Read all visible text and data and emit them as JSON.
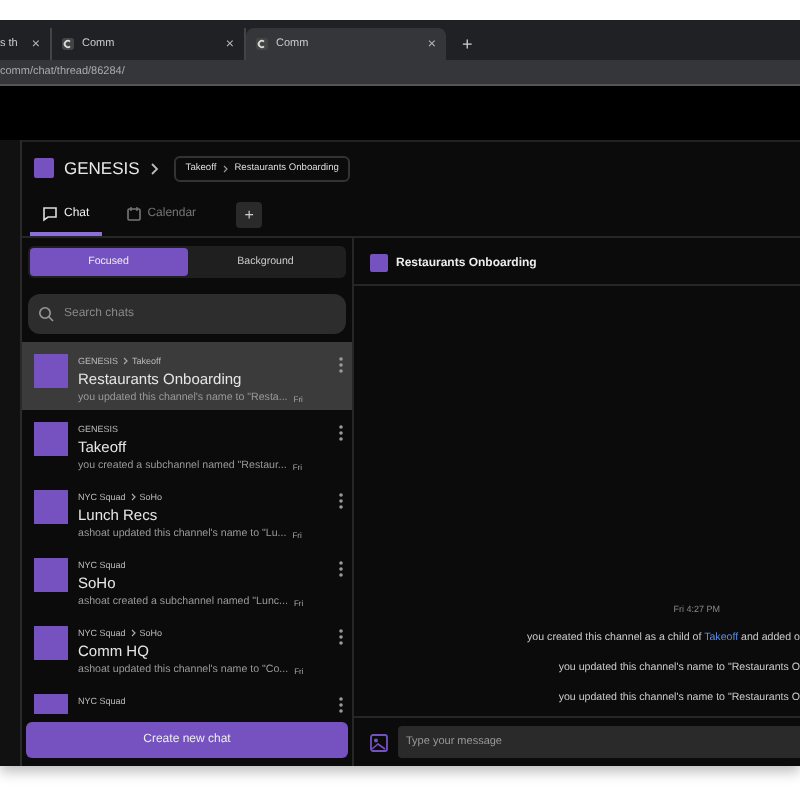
{
  "browser": {
    "tabs": [
      {
        "title": "s th",
        "close": "×",
        "selected": false
      },
      {
        "title": "Comm",
        "close": "×",
        "selected": false
      },
      {
        "title": "Comm",
        "close": "×",
        "selected": true
      }
    ],
    "new_tab": "+",
    "url": "comm/chat/thread/86284/"
  },
  "app": {
    "community": "GENESIS",
    "breadcrumb": [
      "Takeoff",
      "Restaurants Onboarding"
    ],
    "tabs": [
      {
        "label": "Chat",
        "kind": "chat",
        "selected": true
      },
      {
        "label": "Calendar",
        "kind": "calendar",
        "selected": false
      }
    ],
    "add_tab": "+"
  },
  "chat_filter": [
    {
      "label": "Focused",
      "selected": true
    },
    {
      "label": "Background",
      "selected": false
    }
  ],
  "search": {
    "placeholder": "Search chats"
  },
  "chats": [
    {
      "path": [
        "GENESIS",
        "Takeoff"
      ],
      "name": "Restaurants Onboarding",
      "preview": "you updated this channel's name to \"Resta...",
      "time": "Fri",
      "selected": true
    },
    {
      "path": [
        "GENESIS"
      ],
      "name": "Takeoff",
      "preview": "you created a subchannel named \"Restaur...",
      "time": "Fri",
      "selected": false
    },
    {
      "path": [
        "NYC Squad",
        "SoHo"
      ],
      "name": "Lunch Recs",
      "preview": "ashoat updated this channel's name to \"Lu...",
      "time": "Fri",
      "selected": false
    },
    {
      "path": [
        "NYC Squad"
      ],
      "name": "SoHo",
      "preview": "ashoat created a subchannel named \"Lunc...",
      "time": "Fri",
      "selected": false
    },
    {
      "path": [
        "NYC Squad",
        "SoHo"
      ],
      "name": "Comm HQ",
      "preview": "ashoat updated this channel's name to \"Co...",
      "time": "Fri",
      "selected": false
    },
    {
      "path": [
        "NYC Squad"
      ],
      "selected": false
    }
  ],
  "create_button": "Create new chat",
  "thread": {
    "title": "Restaurants Onboarding",
    "timestamp": "Fri 4:27 PM",
    "messages": [
      {
        "text": "you created this channel as a child of ",
        "link": "Takeoff",
        "after": " and added o"
      },
      {
        "text": "you updated this channel's name to \"Restaurants O"
      },
      {
        "text": "you updated this channel's name to \"Restaurants O"
      }
    ],
    "composer": {
      "placeholder": "Type your message"
    }
  }
}
